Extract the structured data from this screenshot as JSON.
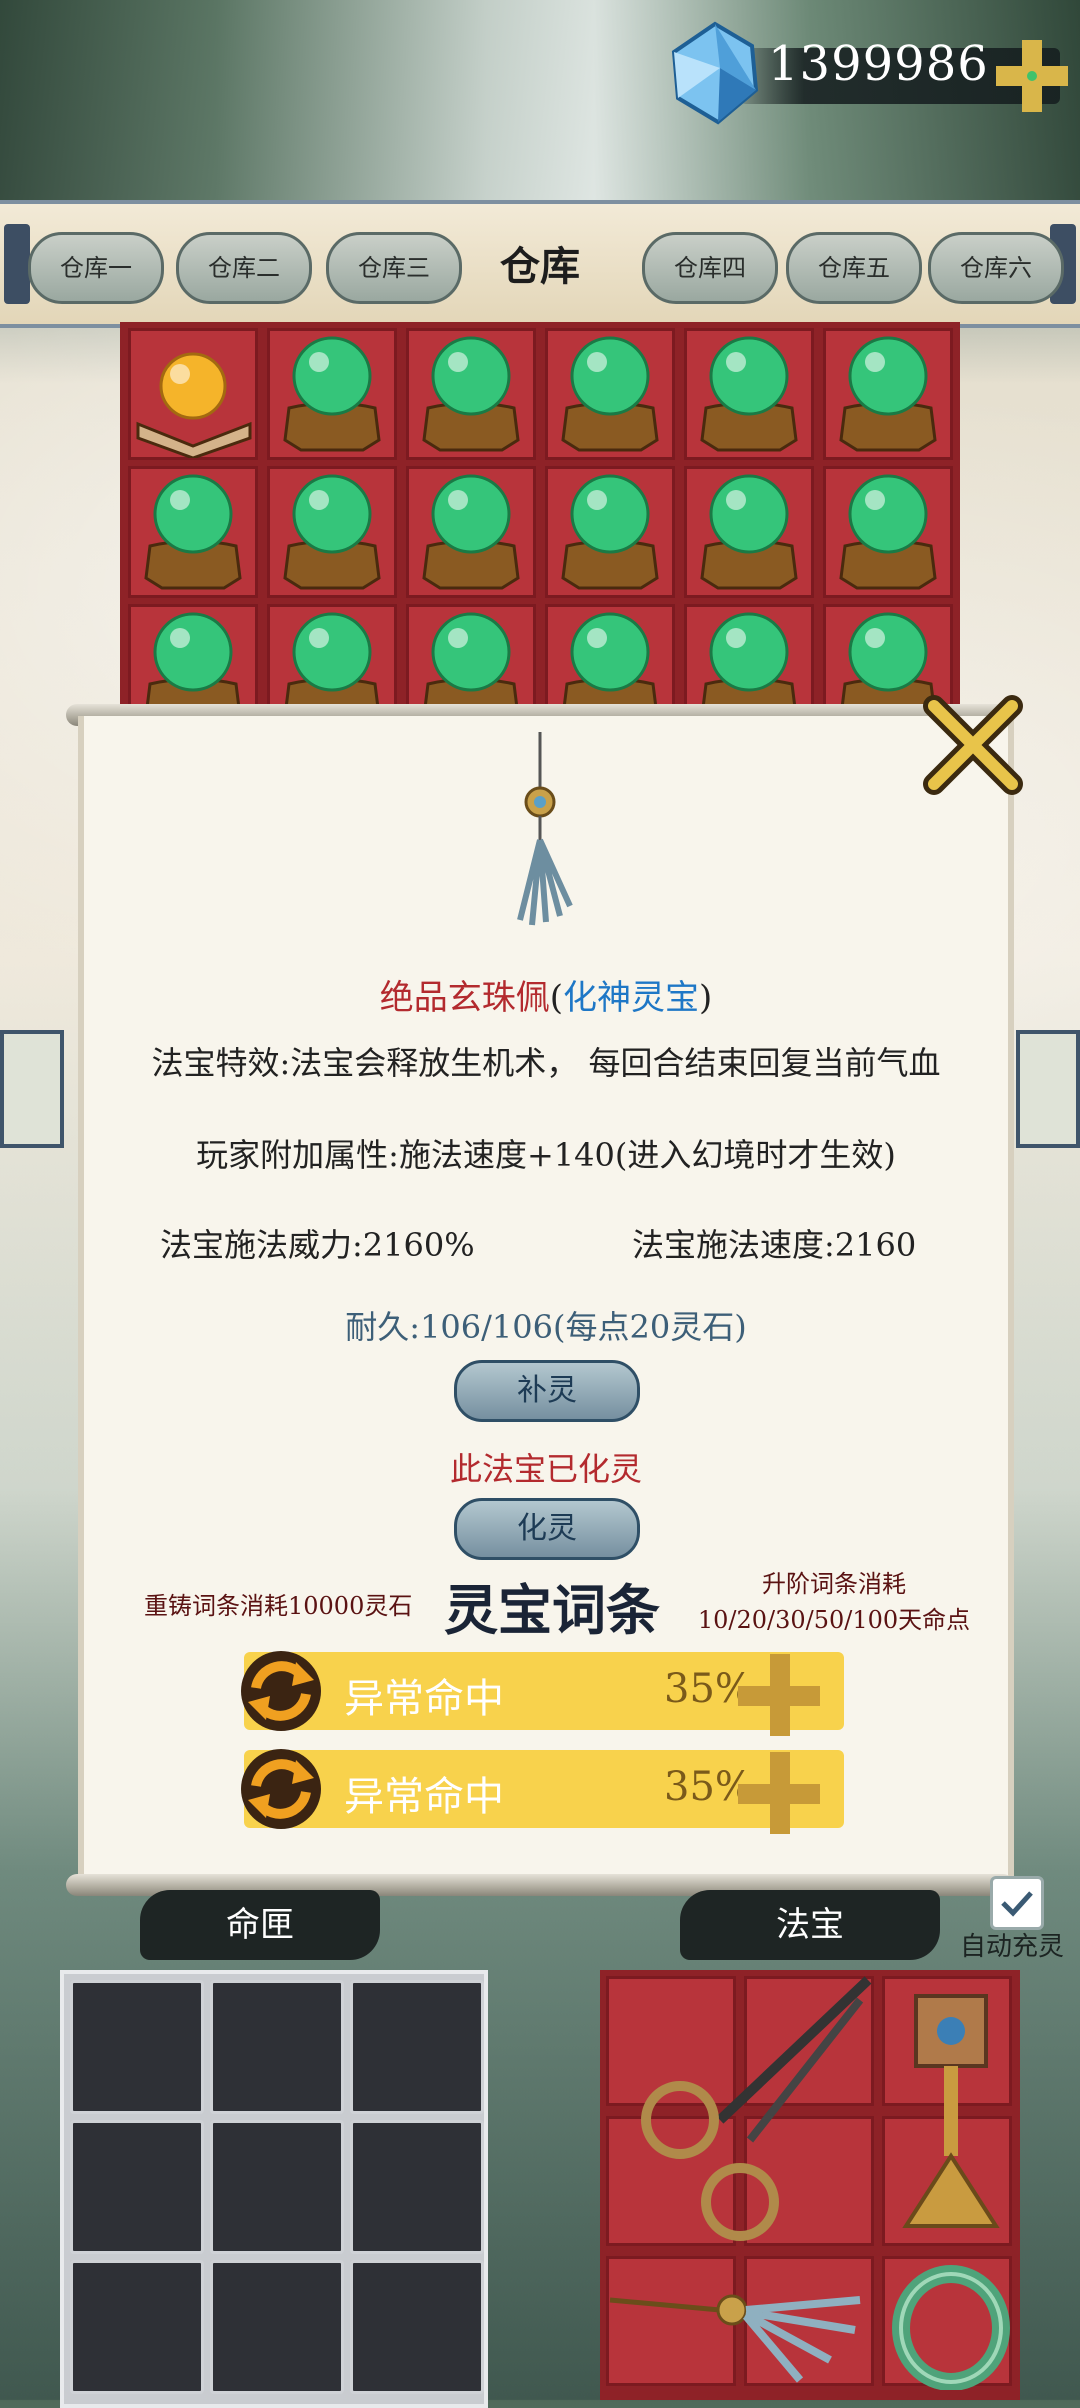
{
  "currency": {
    "amount": "1399986",
    "icon": "gem-icon",
    "add_icon": "plus-icon"
  },
  "tabs": [
    "仓库一",
    "仓库二",
    "仓库三",
    "仓库四",
    "仓库五",
    "仓库六"
  ],
  "tab_title": "仓库",
  "storage": {
    "rows": 3,
    "cols": 6,
    "first_item": "golden-orb-on-stand",
    "other_items": "green-orb-on-stand"
  },
  "popup": {
    "item_name": "绝品玄珠佩",
    "grade_open": "(",
    "grade": "化神灵宝",
    "grade_close": ")",
    "effect": "法宝特效:法宝会释放生机术，   每回合结束回复当前气血",
    "player_attr": "玩家附加属性:施法速度+140(进入幻境时才生效)",
    "power": "法宝施法威力:2160%",
    "speed": "法宝施法速度:2160",
    "durability": "耐久:106/106(每点20灵石)",
    "repair_button": "补灵",
    "spirit_status": "此法宝已化灵",
    "spirit_button": "化灵",
    "reforge_cost": "重铸词条消耗10000灵石",
    "affix_title": "灵宝词条",
    "upgrade_cost_line1": "升阶词条消耗",
    "upgrade_cost_line2": "10/20/30/50/100天命点",
    "affixes": [
      {
        "name": "异常命中",
        "value": "35%"
      },
      {
        "name": "异常命中",
        "value": "35%"
      }
    ]
  },
  "bottom": {
    "left_title": "命匣",
    "right_title": "法宝",
    "auto_label": "自动充灵",
    "auto_checked": true,
    "treasures": [
      "scissors",
      "prayer-wheel",
      "jade-pendant",
      "jade-bracelet"
    ]
  }
}
